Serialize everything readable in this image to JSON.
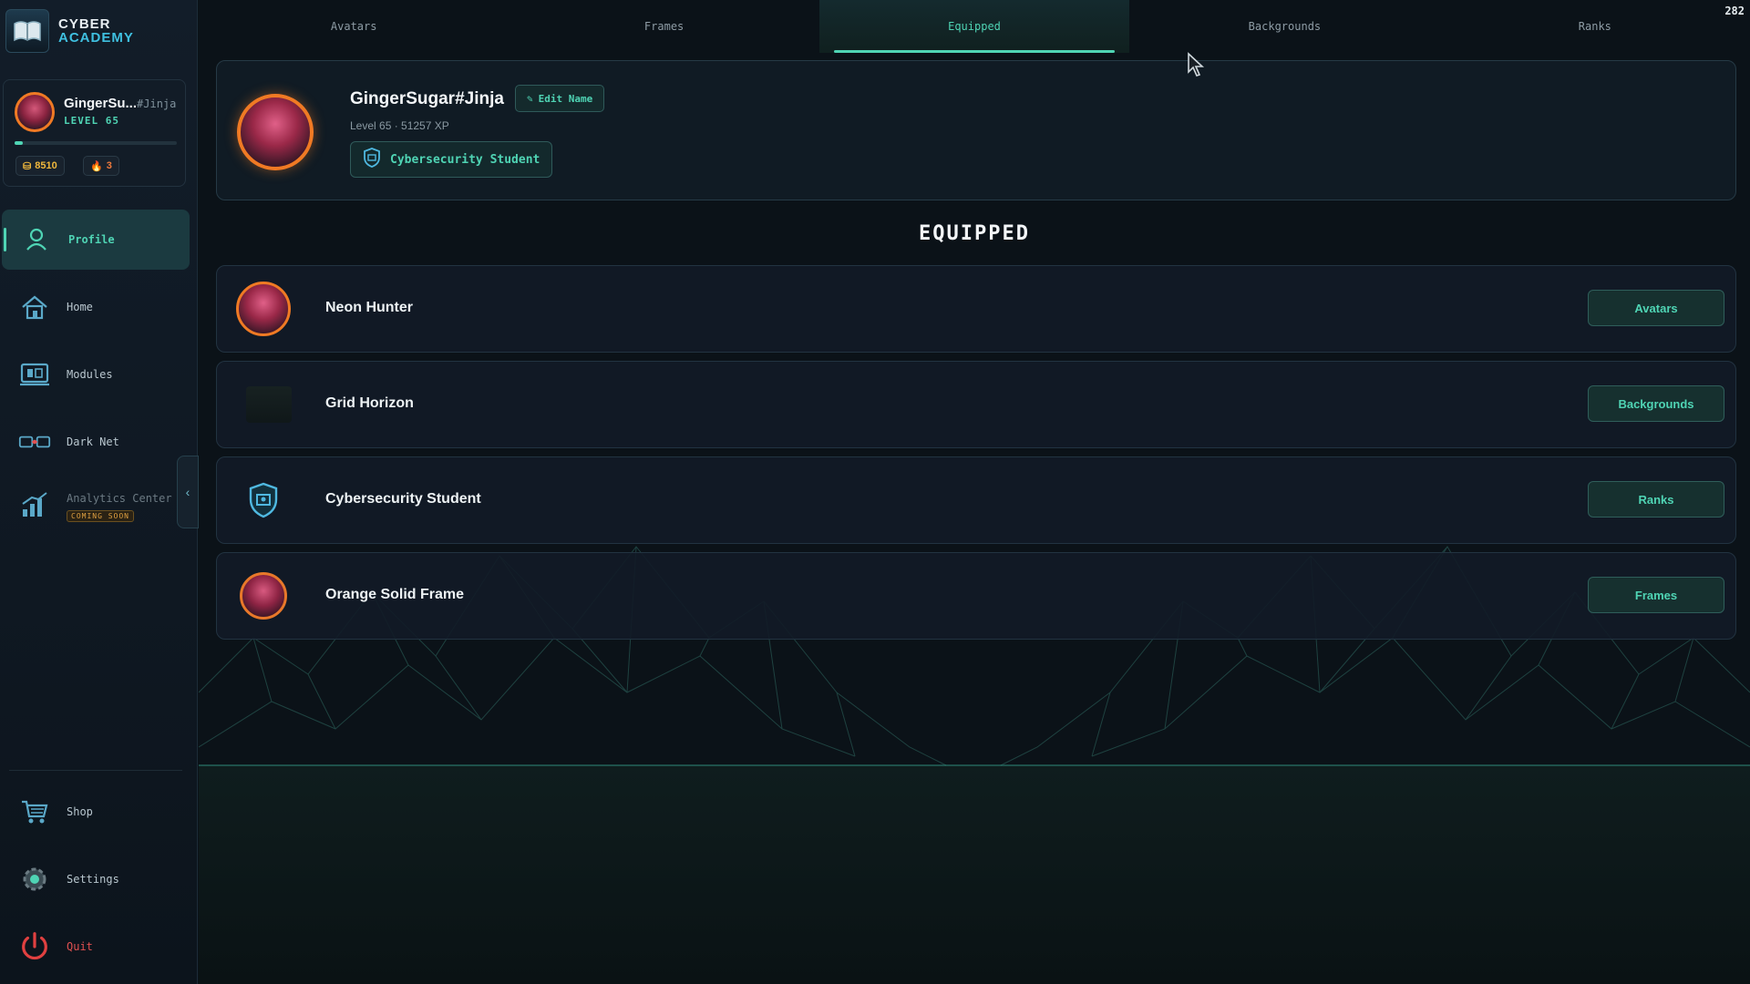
{
  "app": {
    "logo_line1": "CYBER",
    "logo_line2": "ACADEMY",
    "corner_number": "282"
  },
  "user": {
    "short_name": "GingerSu...",
    "tag": "#Jinja",
    "level_label": "LEVEL 65",
    "xp_progress": 0.05,
    "coins": "8510",
    "streak": "3"
  },
  "sidebar": {
    "items": [
      {
        "label": "Profile",
        "icon": "profile-icon",
        "active": true
      },
      {
        "label": "Home",
        "icon": "home-icon"
      },
      {
        "label": "Modules",
        "icon": "modules-icon"
      },
      {
        "label": "Dark Net",
        "icon": "dark-net-icon"
      },
      {
        "label": "Analytics Center",
        "icon": "analytics-icon",
        "badge": "COMING SOON",
        "disabled": true
      }
    ],
    "bottom_items": [
      {
        "label": "Shop",
        "icon": "cart-icon"
      },
      {
        "label": "Settings",
        "icon": "gear-icon"
      },
      {
        "label": "Quit",
        "icon": "power-icon"
      }
    ]
  },
  "tabs": [
    "Avatars",
    "Frames",
    "Equipped",
    "Backgrounds",
    "Ranks"
  ],
  "active_tab": "Equipped",
  "profile": {
    "name": "GingerSugar#Jinja",
    "edit_label": "Edit Name",
    "subline": "Level 65 · 51257 XP",
    "rank": "Cybersecurity Student"
  },
  "section_title": "EQUIPPED",
  "equipped": [
    {
      "name": "Neon Hunter",
      "button": "Avatars",
      "thumb": "avatar"
    },
    {
      "name": "Grid Horizon",
      "button": "Backgrounds",
      "thumb": "background"
    },
    {
      "name": "Cybersecurity Student",
      "button": "Ranks",
      "thumb": "rank-shield"
    },
    {
      "name": "Orange Solid Frame",
      "button": "Frames",
      "thumb": "frame"
    }
  ],
  "colors": {
    "accent": "#4fd4b4",
    "frame_orange": "#f07a24",
    "quit_red": "#e05050"
  }
}
